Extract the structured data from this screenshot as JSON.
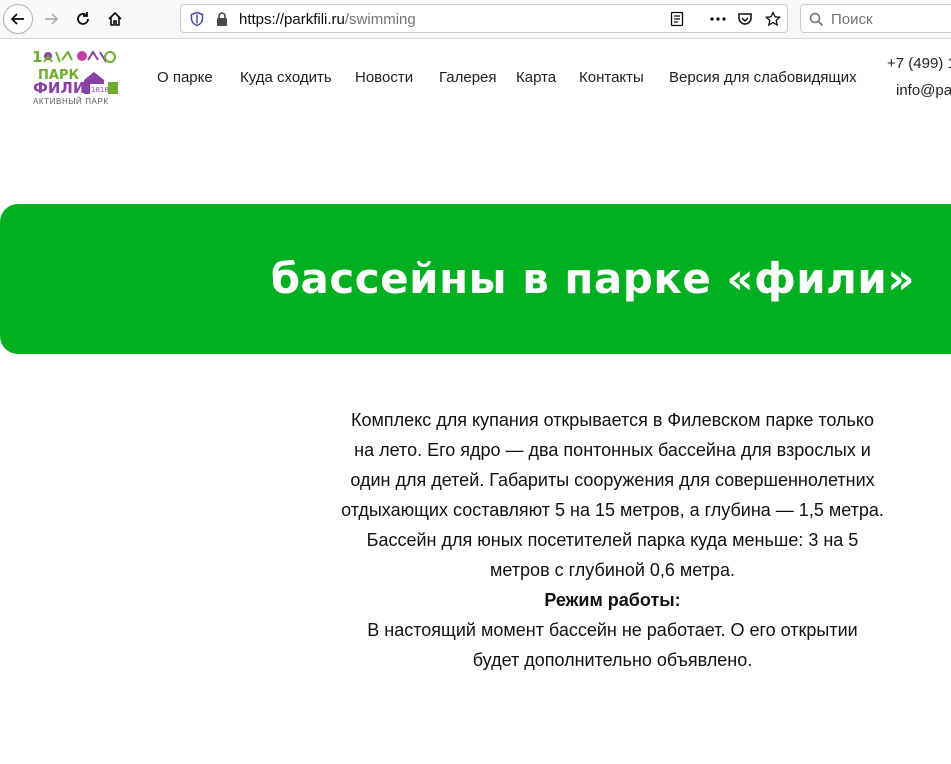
{
  "browser": {
    "url_host": "https://parkfili.ru",
    "url_path": "/swimming",
    "search_placeholder": "Поиск"
  },
  "header": {
    "logo": {
      "title_line1": "ПАРК",
      "title_line2": "ФИЛИ",
      "tagline": "АКТИВНЫЙ ПАРК",
      "badge": "1818"
    },
    "menu": [
      "О парке",
      "Куда сходить",
      "Новости",
      "Галерея",
      "Карта",
      "Контакты",
      "Версия для слабовидящих"
    ],
    "phone": "+7 (499) 1",
    "email": "info@pa"
  },
  "hero": {
    "title": "бассейны в парке «фили»"
  },
  "content": {
    "lines": [
      "Комплекс для купания открывается в Филевском парке только",
      "на лето. Его ядро — два понтонных бассейна для взрослых и",
      "один для детей. Габариты сооружения для совершеннолетних",
      "отдыхающих составляют 5 на 15 метров, а глубина — 1,5 метра.",
      "Бассейн для юных посетителей парка куда меньше: 3 на 5",
      "метров с глубиной 0,6 метра."
    ],
    "hours_label": "Режим работы:",
    "hours_lines": [
      "В настоящий момент бассейн не работает. О его открытии",
      "будет дополнительно объявлено."
    ]
  },
  "colors": {
    "hero_green": "#00b020",
    "logo_green": "#6ab02e",
    "logo_purple": "#8a3fa6"
  }
}
